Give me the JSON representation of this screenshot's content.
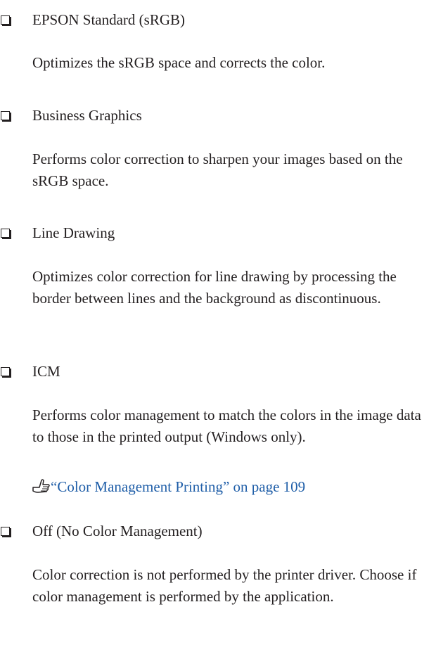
{
  "items": [
    {
      "title": "EPSON Standard (sRGB)",
      "description": "Optimizes the sRGB space and corrects the color."
    },
    {
      "title": "Business Graphics",
      "description": "Performs color correction to sharpen your images based on the sRGB space."
    },
    {
      "title": "Line Drawing",
      "description": "Optimizes color correction for line drawing by processing the border between lines and the background as discontinuous."
    },
    {
      "title": "ICM",
      "description": "Performs color management to match the colors in the image data to those in the printed output (Windows only).",
      "link": "“Color Management Printing” on page 109"
    },
    {
      "title": "Off (No Color Management)",
      "description": "Color correction is not performed by the printer driver. Choose if color management is performed by the application."
    }
  ],
  "colors": {
    "text": "#231f20",
    "link": "#1f5ea8"
  },
  "icons": {
    "bullet": "checkbox-bullet-icon",
    "link": "pointing-hand-icon"
  }
}
